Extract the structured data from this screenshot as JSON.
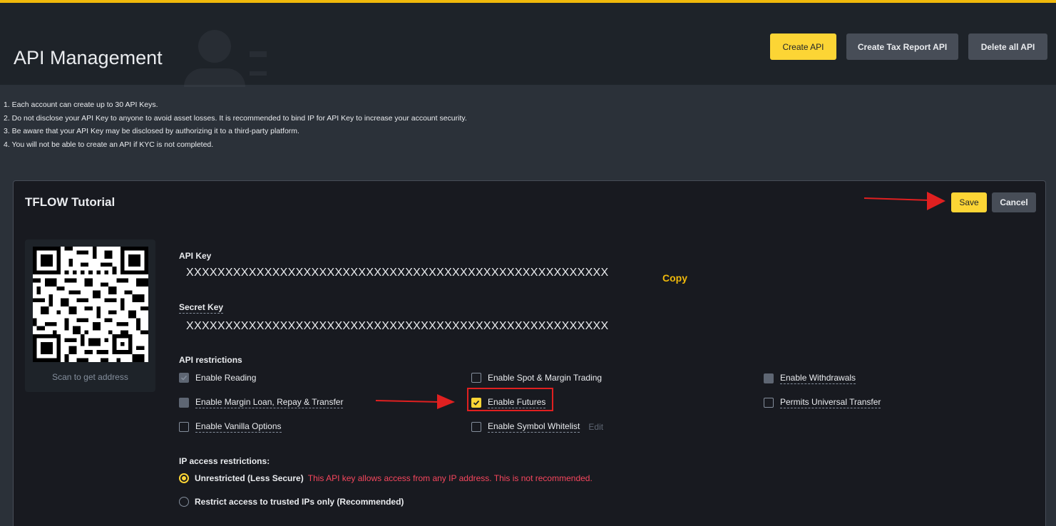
{
  "header": {
    "title": "API Management",
    "buttons": {
      "create_api": "Create API",
      "create_tax": "Create Tax Report API",
      "delete_all": "Delete all API"
    }
  },
  "notes": [
    "1. Each account can create up to 30 API Keys.",
    "2. Do not disclose your API Key to anyone to avoid asset losses. It is recommended to bind IP for API Key to increase your account security.",
    "3. Be aware that your API Key may be disclosed by authorizing it to a third-party platform.",
    "4. You will not be able to create an API if KYC is not completed."
  ],
  "card": {
    "title": "TFLOW Tutorial",
    "save": "Save",
    "cancel": "Cancel",
    "qr_caption": "Scan to get address",
    "api_key_label": "API Key",
    "api_key_value": "XXXXXXXXXXXXXXXXXXXXXXXXXXXXXXXXXXXXXXXXXXXXXXXXXXXXXX",
    "copy": "Copy",
    "secret_key_label": "Secret Key",
    "secret_key_value": "XXXXXXXXXXXXXXXXXXXXXXXXXXXXXXXXXXXXXXXXXXXXXXXXXXXXXX",
    "restrictions_label": "API restrictions",
    "restrictions": {
      "reading": "Enable Reading",
      "spot_margin": "Enable Spot & Margin Trading",
      "withdrawals": "Enable Withdrawals",
      "margin_loan": "Enable Margin Loan, Repay & Transfer",
      "futures": "Enable Futures",
      "universal": "Permits Universal Transfer",
      "vanilla": "Enable Vanilla Options",
      "symbol_whitelist": "Enable Symbol Whitelist",
      "edit": "Edit"
    },
    "ip_label": "IP access restrictions:",
    "ip_unrestricted": "Unrestricted (Less Secure)",
    "ip_warning": "This API key allows access from any IP address. This is not recommended.",
    "ip_restricted": "Restrict access to trusted IPs only (Recommended)"
  },
  "colors": {
    "accent": "#fcd535",
    "warning": "#f6465d",
    "annotation": "#e02020"
  }
}
